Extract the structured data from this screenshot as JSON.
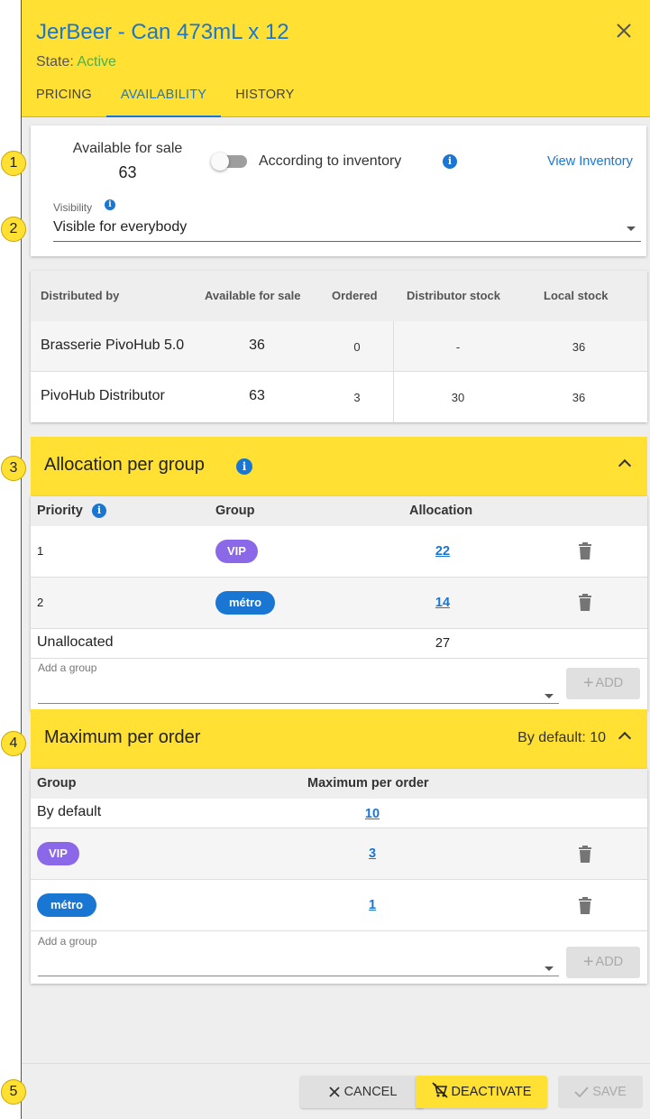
{
  "header": {
    "title": "JerBeer - Can 473mL x 12",
    "state_label": "State:",
    "state_value": "Active",
    "tabs": [
      "PRICING",
      "AVAILABILITY",
      "HISTORY"
    ]
  },
  "availability": {
    "available_label": "Available for sale",
    "available_value": "63",
    "toggle_label": "According to inventory",
    "view_inventory": "View Inventory",
    "visibility_label": "Visibility",
    "visibility_value": "Visible for everybody"
  },
  "distributors": {
    "columns": [
      "Distributed by",
      "Available for sale",
      "Ordered",
      "Distributor stock",
      "Local stock"
    ],
    "rows": [
      {
        "name": "Brasserie PivoHub 5.0",
        "available": "36",
        "ordered": "0",
        "distributor_stock": "-",
        "local_stock": "36"
      },
      {
        "name": "PivoHub Distributor",
        "available": "63",
        "ordered": "3",
        "distributor_stock": "30",
        "local_stock": "36"
      }
    ]
  },
  "allocation": {
    "title": "Allocation per group",
    "columns": [
      "Priority",
      "Group",
      "Allocation"
    ],
    "rows": [
      {
        "priority": "1",
        "group": "VIP",
        "allocation": "22"
      },
      {
        "priority": "2",
        "group": "métro",
        "allocation": "14"
      }
    ],
    "unallocated_label": "Unallocated",
    "unallocated_value": "27",
    "add_group_label": "Add a group",
    "add_button": "ADD"
  },
  "max_per_order": {
    "title": "Maximum per order",
    "default_summary": "By default: 10",
    "columns": [
      "Group",
      "Maximum per order"
    ],
    "default_label": "By default",
    "default_value": "10",
    "rows": [
      {
        "group": "VIP",
        "value": "3"
      },
      {
        "group": "métro",
        "value": "1"
      }
    ],
    "add_group_label": "Add a group",
    "add_button": "ADD"
  },
  "footer": {
    "cancel": "CANCEL",
    "deactivate": "DEACTIVATE",
    "save": "SAVE"
  },
  "callouts": [
    "1",
    "2",
    "3",
    "4",
    "5"
  ],
  "colors": {
    "accent_yellow": "#ffe033",
    "link_blue": "#1976d2",
    "active_green": "#4caf50",
    "vip_purple": "#8b68e8",
    "metro_blue": "#1976d2"
  }
}
